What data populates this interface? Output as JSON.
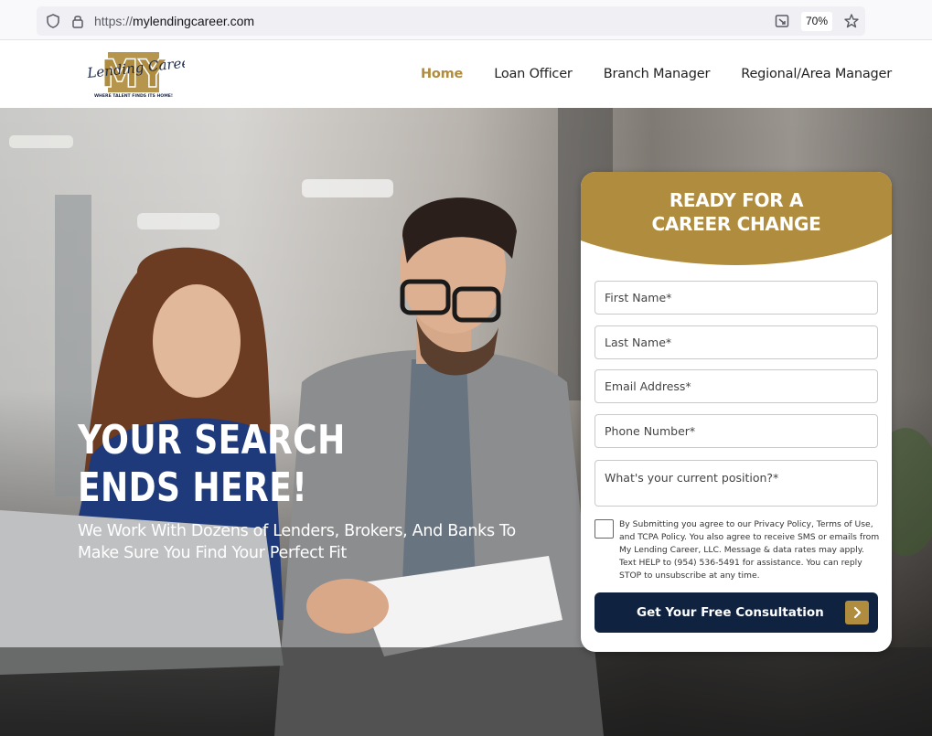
{
  "browser": {
    "url_prefix": "https://",
    "url_domain": "mylendingcareer.com",
    "zoom": "70%",
    "icons": [
      "shield-icon",
      "lock-icon",
      "reader-icon",
      "star-icon"
    ]
  },
  "header": {
    "logo": {
      "mark": "MY",
      "script": "Lending Career",
      "tagline": "WHERE TALENT FINDS ITS HOME!"
    },
    "nav": [
      {
        "label": "Home",
        "active": true
      },
      {
        "label": "Loan Officer",
        "active": false
      },
      {
        "label": "Branch Manager",
        "active": false
      },
      {
        "label": "Regional/Area Manager",
        "active": false
      }
    ]
  },
  "hero": {
    "title": "YOUR SEARCH ENDS HERE!",
    "subtitle": "We Work With Dozens of Lenders, Brokers, And Banks To Make Sure You Find Your Perfect Fit"
  },
  "form": {
    "title_line1": "READY FOR A",
    "title_line2": "CAREER CHANGE",
    "fields": {
      "first_name": "First Name*",
      "last_name": "Last Name*",
      "email": "Email Address*",
      "phone": "Phone Number*",
      "position": "What's your current position?*"
    },
    "consent": "By Submitting you agree to our Privacy Policy, Terms of Use, and TCPA Policy. You also agree to receive SMS or emails from My Lending Career, LLC. Message & data rates may apply. Text HELP to (954) 536-5491 for assistance. You can reply STOP to unsubscribe at any time.",
    "submit_label": "Get Your Free Consultation"
  },
  "colors": {
    "gold": "#b08c3e",
    "navy": "#0f2240",
    "white": "#ffffff"
  }
}
